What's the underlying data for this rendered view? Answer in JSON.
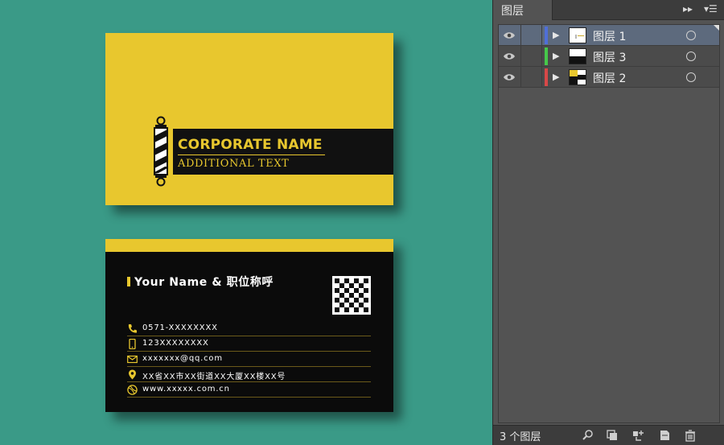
{
  "canvas": {
    "front_card": {
      "corporate_name": "CORPORATE NAME",
      "additional_text": "ADDITIONAL TEXT",
      "logo_icon": "barber-pole-icon"
    },
    "back_card": {
      "name_title": "Your Name & 职位称呼",
      "qr_icon": "qr-code-icon",
      "contacts": [
        {
          "icon": "phone-icon",
          "text": "0571-XXXXXXXX"
        },
        {
          "icon": "mobile-icon",
          "text": "123XXXXXXXX"
        },
        {
          "icon": "email-icon",
          "text": "xxxxxxx@qq.com"
        },
        {
          "icon": "location-icon",
          "text": "XX省XX市XX街道XX大厦XX楼XX号"
        },
        {
          "icon": "globe-icon",
          "text": "www.xxxxx.com.cn"
        }
      ]
    },
    "colors": {
      "background": "#3a9a87",
      "accent_yellow": "#e8c72e",
      "card_black": "#0b0b0b"
    }
  },
  "panel": {
    "title": "图层",
    "forward_icon": "double-chevron-right-icon",
    "menu_icon": "panel-menu-icon",
    "layers": [
      {
        "name": "图层 1",
        "color": "#4f6fd8",
        "selected": true
      },
      {
        "name": "图层 3",
        "color": "#46c84a",
        "selected": false
      },
      {
        "name": "图层 2",
        "color": "#d84848",
        "selected": false
      }
    ],
    "footer": {
      "count": "3 个图层",
      "icons": [
        "search-icon",
        "clipping-mask-icon",
        "new-sublayer-icon",
        "new-layer-icon",
        "trash-icon"
      ]
    }
  }
}
